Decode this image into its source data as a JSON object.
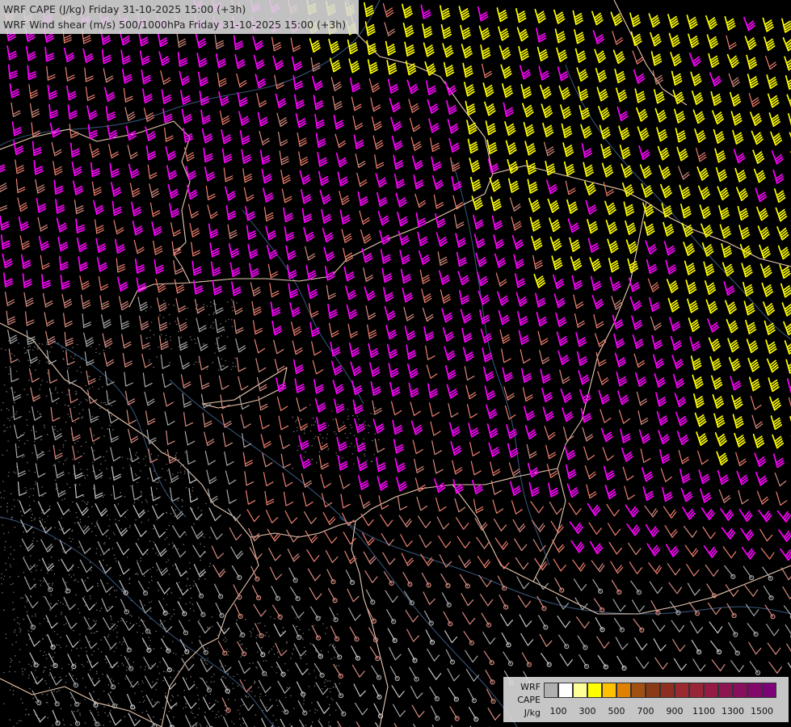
{
  "title": {
    "line1": "WRF CAPE (J/kg) Friday 31-10-2025 15:00 (+3h)",
    "line2": "WRF Wind shear (m/s) 500/1000hPa Friday 31-10-2025 15:00 (+3h)"
  },
  "legend": {
    "model": "WRF",
    "variable": "CAPE",
    "unit": "J/kg",
    "colors": [
      "#b0b0b0",
      "#ffffff",
      "#ffff9a",
      "#ffff00",
      "#ffc000",
      "#e08000",
      "#a05010",
      "#8a3a14",
      "#8e2e20",
      "#9a2a30",
      "#982438",
      "#941c44",
      "#8e1650",
      "#880e5e",
      "#82086a",
      "#7c0278"
    ],
    "tick_labels": [
      "100",
      "300",
      "500",
      "700",
      "900",
      "1100",
      "1300",
      "1500"
    ]
  },
  "barb_colors": {
    "magenta": "#ff00ff",
    "yellow": "#ffff00",
    "salmon": "#f08070",
    "rose": "#d88c80",
    "grey": "#a8a8a8",
    "lightgrey": "#c8c8c8"
  },
  "map_colors": {
    "background": "#000000",
    "borders": "#e8c8b0",
    "rivers": "#3a5a80",
    "terrain": "#9a9a9a"
  }
}
